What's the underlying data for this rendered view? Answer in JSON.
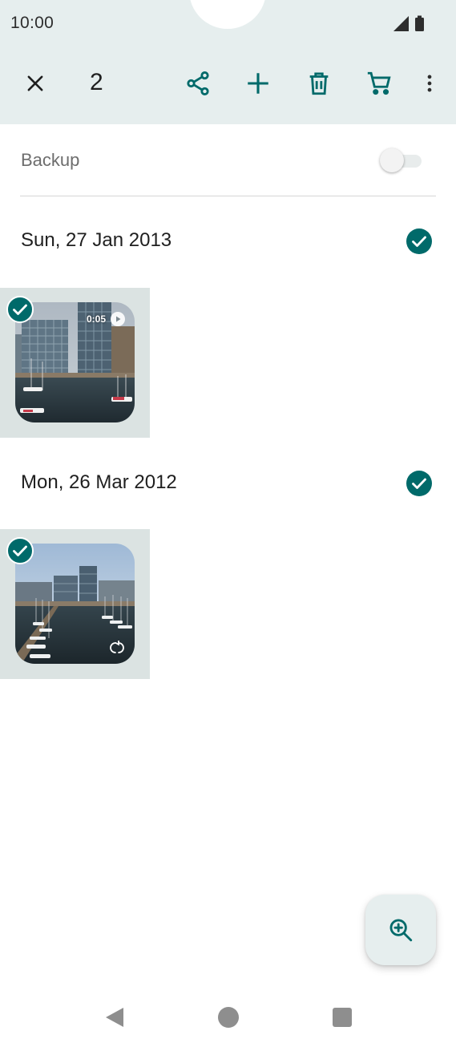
{
  "status_bar": {
    "time": "10:00"
  },
  "action_bar": {
    "selected_count": "2"
  },
  "backup": {
    "label": "Backup",
    "enabled": false
  },
  "groups": [
    {
      "date": "Sun, 27 Jan 2013",
      "items": [
        {
          "type": "video",
          "duration": "0:05",
          "selected": true
        }
      ]
    },
    {
      "date": "Mon, 26 Mar 2012",
      "items": [
        {
          "type": "motion-photo",
          "selected": true
        }
      ]
    }
  ],
  "colors": {
    "accent": "#006a6a",
    "topbar": "#e6eeee",
    "tile": "#dbe3e2"
  }
}
